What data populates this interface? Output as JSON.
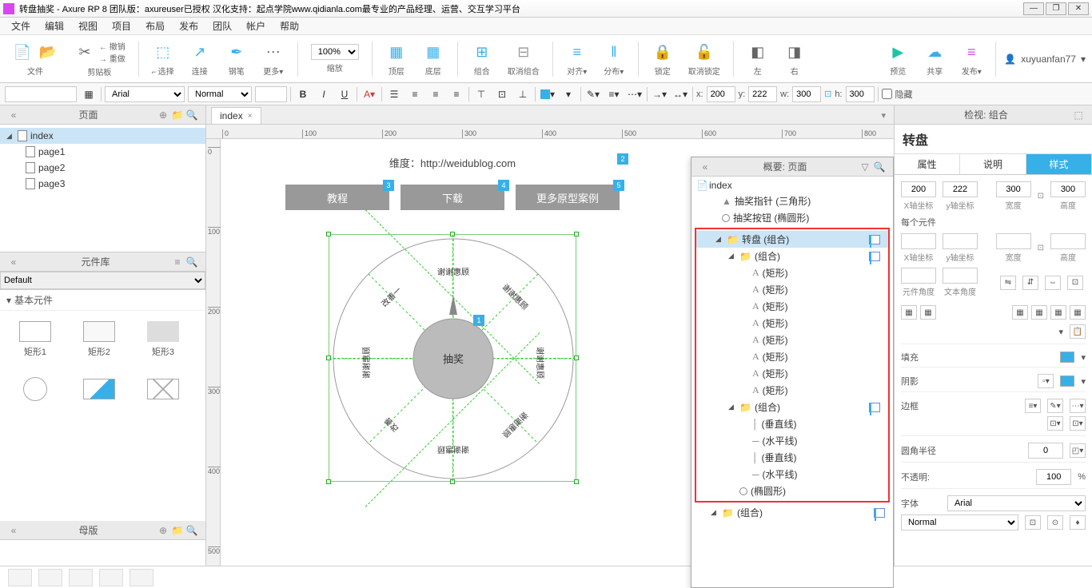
{
  "title": "转盘抽奖 - Axure RP 8 团队版：axureuser已授权 汉化支持：起点学院www.qidianla.com最专业的产品经理、运营、交互学习平台",
  "menu": [
    "文件",
    "编辑",
    "视图",
    "项目",
    "布局",
    "发布",
    "团队",
    "帐户",
    "帮助"
  ],
  "toolbar": {
    "file": "文件",
    "clipboard": "剪贴板",
    "undo": "撤销",
    "redo": "重做",
    "select": "选择",
    "connect": "连接",
    "pen": "钢笔",
    "more": "更多",
    "zoom": "100%",
    "zoomLabel": "缩放",
    "top": "顶层",
    "bottom": "底层",
    "group": "组合",
    "ungroup": "取消组合",
    "align": "对齐",
    "distribute": "分布",
    "lock": "锁定",
    "unlock": "取消锁定",
    "left": "左",
    "right": "右",
    "preview": "预览",
    "share": "共享",
    "publish": "发布",
    "user": "xuyuanfan77"
  },
  "format": {
    "font": "Arial",
    "weight": "Normal",
    "x": "200",
    "y": "222",
    "w": "300",
    "h": "300",
    "xLabel": "x:",
    "yLabel": "y:",
    "wLabel": "w:",
    "hLabel": "h:",
    "hidden": "隐藏"
  },
  "leftPanels": {
    "pages": {
      "title": "页面",
      "items": [
        "index",
        "page1",
        "page2",
        "page3"
      ]
    },
    "library": {
      "title": "元件库",
      "select": "Default",
      "section": "基本元件",
      "items": [
        "矩形1",
        "矩形2",
        "矩形3"
      ]
    },
    "masters": {
      "title": "母版"
    }
  },
  "tabs": [
    "index"
  ],
  "canvas": {
    "dimText": "维度：http://weidublog.com",
    "buttons": [
      "教程",
      "下载",
      "更多原型案例"
    ],
    "center": "抽奖",
    "slices": [
      "谢谢惠顾",
      "谢谢惠顾",
      "谢谢惠顾",
      "改善一",
      "改善",
      "轻奖",
      "谢谢惠顾",
      "谢谢惠顾"
    ]
  },
  "outline": {
    "title": "概要: 页面",
    "root": "index",
    "items": [
      {
        "name": "抽奖指针 (三角形)",
        "icon": "tri",
        "indent": 1
      },
      {
        "name": "抽奖按钮 (椭圆形)",
        "icon": "circle",
        "indent": 1
      },
      {
        "name": "转盘 (组合)",
        "icon": "folder",
        "indent": 1,
        "sel": true,
        "highlight": "start"
      },
      {
        "name": "(组合)",
        "icon": "folder",
        "indent": 2
      },
      {
        "name": "(矩形)",
        "icon": "A",
        "indent": 3
      },
      {
        "name": "(矩形)",
        "icon": "A",
        "indent": 3
      },
      {
        "name": "(矩形)",
        "icon": "A",
        "indent": 3
      },
      {
        "name": "(矩形)",
        "icon": "A",
        "indent": 3
      },
      {
        "name": "(矩形)",
        "icon": "A",
        "indent": 3
      },
      {
        "name": "(矩形)",
        "icon": "A",
        "indent": 3
      },
      {
        "name": "(矩形)",
        "icon": "A",
        "indent": 3
      },
      {
        "name": "(矩形)",
        "icon": "A",
        "indent": 3
      },
      {
        "name": "(组合)",
        "icon": "folder",
        "indent": 2
      },
      {
        "name": "(垂直线)",
        "icon": "vline",
        "indent": 3
      },
      {
        "name": "(水平线)",
        "icon": "hline",
        "indent": 3
      },
      {
        "name": "(垂直线)",
        "icon": "vline",
        "indent": 3
      },
      {
        "name": "(水平线)",
        "icon": "hline",
        "indent": 3
      },
      {
        "name": "(椭圆形)",
        "icon": "circle",
        "indent": 2,
        "highlight": "end"
      },
      {
        "name": "(组合)",
        "icon": "folder",
        "indent": 1
      }
    ]
  },
  "inspector": {
    "header": "检视: 组合",
    "name": "转盘",
    "tabs": [
      "属性",
      "说明",
      "样式"
    ],
    "pos": {
      "x": "200",
      "y": "222",
      "w": "300",
      "h": "300",
      "xl": "X轴坐标",
      "yl": "y轴坐标",
      "wl": "宽度",
      "hl": "高度"
    },
    "each": "每个元件",
    "angle": "元件角度",
    "textAngle": "文本角度",
    "fill": "填充",
    "shadow": "阴影",
    "border": "边框",
    "corner": "圆角半径",
    "cornerVal": "0",
    "opacity": "不透明:",
    "opacityVal": "100",
    "pct": "%",
    "fontLabel": "字体",
    "fontVal": "Arial",
    "styleVal": "Normal"
  }
}
